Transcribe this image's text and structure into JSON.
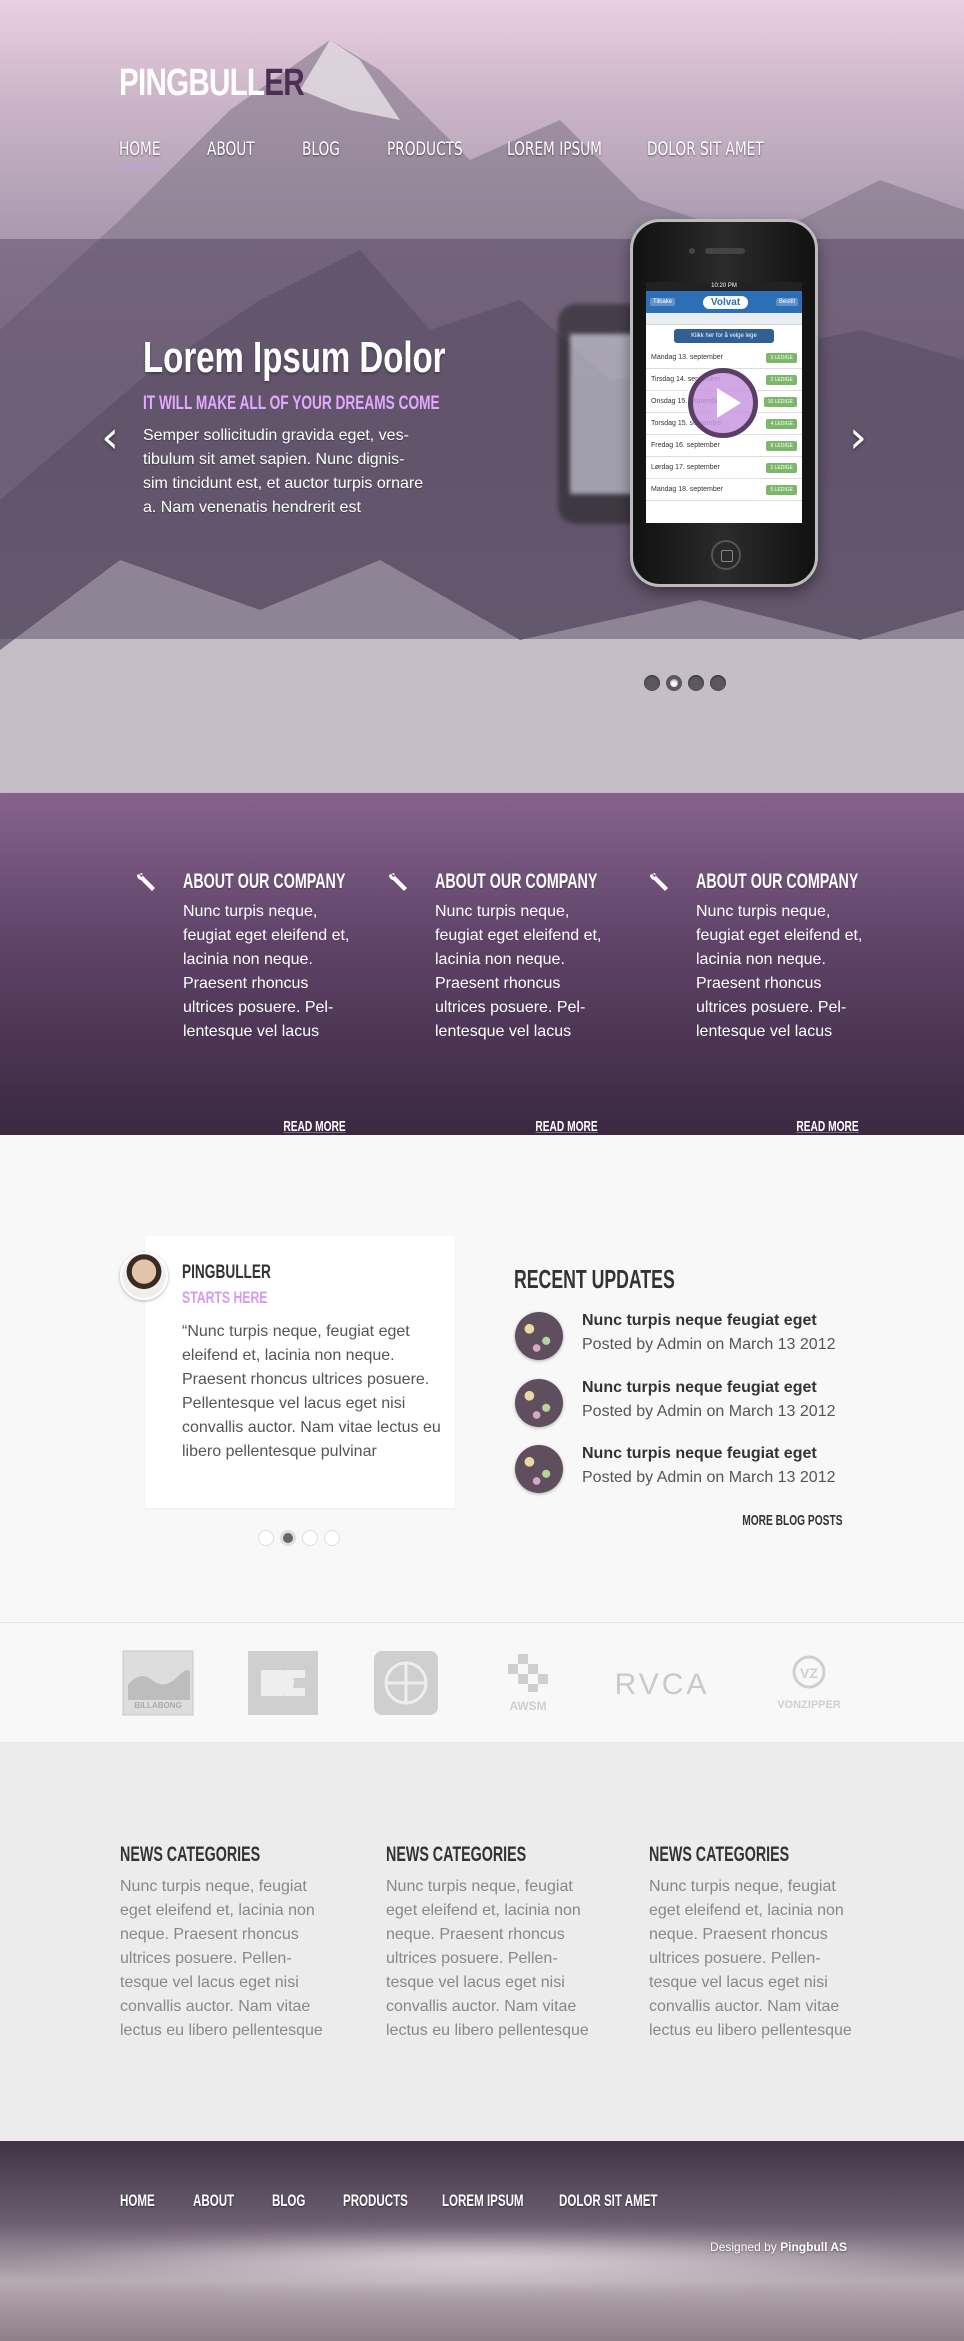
{
  "header": {
    "logo_main": "PINGBULL",
    "logo_accent": "ER",
    "nav": [
      "HOME",
      "ABOUT",
      "BLOG",
      "PRODUCTS",
      "LOREM IPSUM",
      "DOLOR SIT AMET"
    ],
    "active_nav": "HOME"
  },
  "slider": {
    "title": "Lorem Ipsum Dolor",
    "subtitle": "IT WILL MAKE ALL OF YOUR DREAMS COME",
    "text": "Semper sollicitudin gravida eget, ves- tibulum sit amet sapien. Nunc dignis- sim tincidunt est, et auctor turpis ornare a. Nam venenatis hendrerit est",
    "prev_icon": "chevron-left-icon",
    "next_icon": "chevron-right-icon",
    "dots": 4,
    "active_dot": 2,
    "phone": {
      "time": "10:20 PM",
      "left_btn": "Tilbake",
      "brand": "Volvat",
      "right_btn": "Bestill",
      "button": "Klikk her for å velge lege",
      "rows": [
        {
          "label": "Mandag 13. september",
          "tag": "3 LEDIGE"
        },
        {
          "label": "Tirsdag 14. september",
          "tag": "2 LEDIGE"
        },
        {
          "label": "Onsdag 15. september",
          "tag": "10 LEDIGE"
        },
        {
          "label": "Torsdag 15. september",
          "tag": "4 LEDIGE"
        },
        {
          "label": "Fredag 16. september",
          "tag": "8 LEDIGE"
        },
        {
          "label": "Lørdag 17. september",
          "tag": "1 LEDIGE"
        },
        {
          "label": "Mandag 18. september",
          "tag": "5 LEDIGE"
        }
      ]
    }
  },
  "features": [
    {
      "title": "ABOUT OUR COMPANY",
      "text": "Nunc turpis neque, feugiat eget eleifend et, lacinia non neque. Praesent rhoncus ultrices posuere. Pel- lentesque vel lacus",
      "link": "READ MORE"
    },
    {
      "title": "ABOUT OUR COMPANY",
      "text": "Nunc turpis neque, feugiat eget eleifend et, lacinia non neque. Praesent rhoncus ultrices posuere. Pel- lentesque vel lacus",
      "link": "READ MORE"
    },
    {
      "title": "ABOUT OUR COMPANY",
      "text": "Nunc turpis neque, feugiat eget eleifend et, lacinia non neque. Praesent rhoncus ultrices posuere. Pel- lentesque vel lacus",
      "link": "READ MORE"
    }
  ],
  "testimonial": {
    "name": "PINGBULLER",
    "subtitle": "STARTS HERE",
    "quote": "“Nunc turpis neque, feugiat eget eleifend et, lacinia non neque. Praesent rhoncus ultrices posuere. Pellentesque vel lacus eget nisi convallis auctor. Nam vitae lectus eu libero pellentesque pulvinar",
    "dots": 4,
    "active_dot": 2
  },
  "updates": {
    "title": "RECENT UPDATES",
    "items": [
      {
        "title": "Nunc turpis neque feugiat eget",
        "meta": "Posted by Admin on March 13 2012"
      },
      {
        "title": "Nunc turpis neque feugiat eget",
        "meta": "Posted by Admin on March 13 2012"
      },
      {
        "title": "Nunc turpis neque feugiat eget",
        "meta": "Posted by Admin on March 13 2012"
      }
    ],
    "more": "MORE BLOG POSTS"
  },
  "brands": [
    "BILLABONG",
    "DC",
    "ELEMENT",
    "AWSM",
    "RVCA",
    "VONZIPPER"
  ],
  "news": [
    {
      "title": "NEWS CATEGORIES",
      "text": "Nunc turpis neque, feugiat eget eleifend et, lacinia non neque. Praesent rhoncus ultrices posuere. Pellen- tesque vel lacus eget nisi convallis auctor. Nam vitae lectus eu libero pellentesque"
    },
    {
      "title": "NEWS CATEGORIES",
      "text": "Nunc turpis neque, feugiat eget eleifend et, lacinia non neque. Praesent rhoncus ultrices posuere. Pellen- tesque vel lacus eget nisi convallis auctor. Nam vitae lectus eu libero pellentesque"
    },
    {
      "title": "NEWS CATEGORIES",
      "text": "Nunc turpis neque, feugiat eget eleifend et, lacinia non neque. Praesent rhoncus ultrices posuere. Pellen- tesque vel lacus eget nisi convallis auctor. Nam vitae lectus eu libero pellentesque"
    }
  ],
  "footer": {
    "nav": [
      "HOME",
      "ABOUT",
      "BLOG",
      "PRODUCTS",
      "LOREM IPSUM",
      "DOLOR SIT AMET"
    ],
    "credit_prefix": "Designed by",
    "credit_name": "Pingbull AS"
  },
  "colors": {
    "accent": "#d59af2",
    "purple_dark": "#3a2841",
    "purple_mid": "#86638e"
  }
}
